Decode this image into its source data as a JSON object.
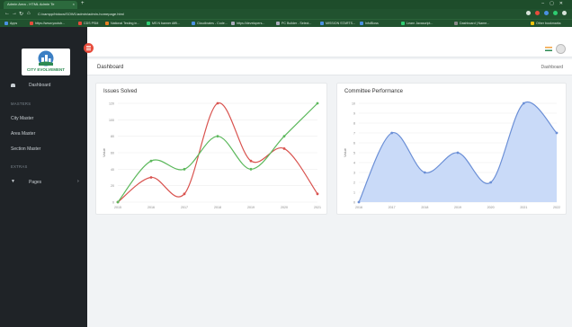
{
  "browser": {
    "tab_title": "Admin Area - HTML Admin Te",
    "tab_close": "×",
    "new_tab": "+",
    "url": "C:/xampp/htdocs/SOW1/admin/admin-homepage.html",
    "bookmarks": [
      {
        "label": "Apps",
        "color": "#4a90e2"
      },
      {
        "label": "https://www.youtub...",
        "color": "#e74c3c"
      },
      {
        "label": "CDS PSM",
        "color": "#e74c3c"
      },
      {
        "label": "National Testing in...",
        "color": "#e67e22"
      },
      {
        "label": "MS N banner Affli...",
        "color": "#2ecc71"
      },
      {
        "label": "Cloudinates - Code...",
        "color": "#4a90e2"
      },
      {
        "label": "https://developers...",
        "color": "#aab"
      },
      {
        "label": "PC Builder - Select...",
        "color": "#aab"
      },
      {
        "label": "MISSION STARTS...",
        "color": "#4a90e2"
      },
      {
        "label": "InfoBloss",
        "color": "#4a90e2"
      },
      {
        "label": "Learn Javascript...",
        "color": "#2ecc71"
      },
      {
        "label": "Dashboard | Name...",
        "color": "#888"
      },
      {
        "label": "Other bookmarks",
        "color": "#f1c40f"
      }
    ]
  },
  "app": {
    "logo_text": "CITY EVOLVEMENT",
    "sidebar": {
      "dashboard": "Dashboard",
      "masters_heading": "MASTERS",
      "masters": [
        "City Master",
        "Area Master",
        "Section Master"
      ],
      "extras_heading": "EXTRAS",
      "pages": "Pages"
    },
    "breadcrumb_title": "Dashboard",
    "breadcrumb_right": "Dashboard"
  },
  "colors": {
    "sidebar_bg": "#1f2327",
    "accent_red": "#e74c3c",
    "series_red": "#d9534f",
    "series_green": "#5cb85c",
    "area_fill": "#c9daf8",
    "area_stroke": "#6b8fd6"
  },
  "chart_data": [
    {
      "type": "line",
      "title": "Issues Solved",
      "ylabel": "Value",
      "x": [
        "2015",
        "2016",
        "2017",
        "2018",
        "2019",
        "2020",
        "2021"
      ],
      "ylim": [
        0,
        120
      ],
      "yticks": [
        0,
        20,
        40,
        60,
        80,
        100,
        120
      ],
      "series": [
        {
          "values": [
            0,
            30,
            10,
            120,
            50,
            65,
            10
          ],
          "color": "#d9534f"
        },
        {
          "values": [
            0,
            50,
            40,
            80,
            40,
            80,
            120
          ],
          "color": "#5cb85c"
        }
      ]
    },
    {
      "type": "area",
      "title": "Committee Performance",
      "ylabel": "Value",
      "x": [
        "2016",
        "2017",
        "2018",
        "2019",
        "2020",
        "2021",
        "2022"
      ],
      "ylim": [
        0,
        10
      ],
      "yticks": [
        0,
        1,
        2,
        3,
        4,
        5,
        6,
        7,
        8,
        9,
        10
      ],
      "series": [
        {
          "values": [
            0,
            7,
            3,
            5,
            2,
            10,
            7
          ],
          "color": "#6b8fd6"
        }
      ]
    }
  ]
}
